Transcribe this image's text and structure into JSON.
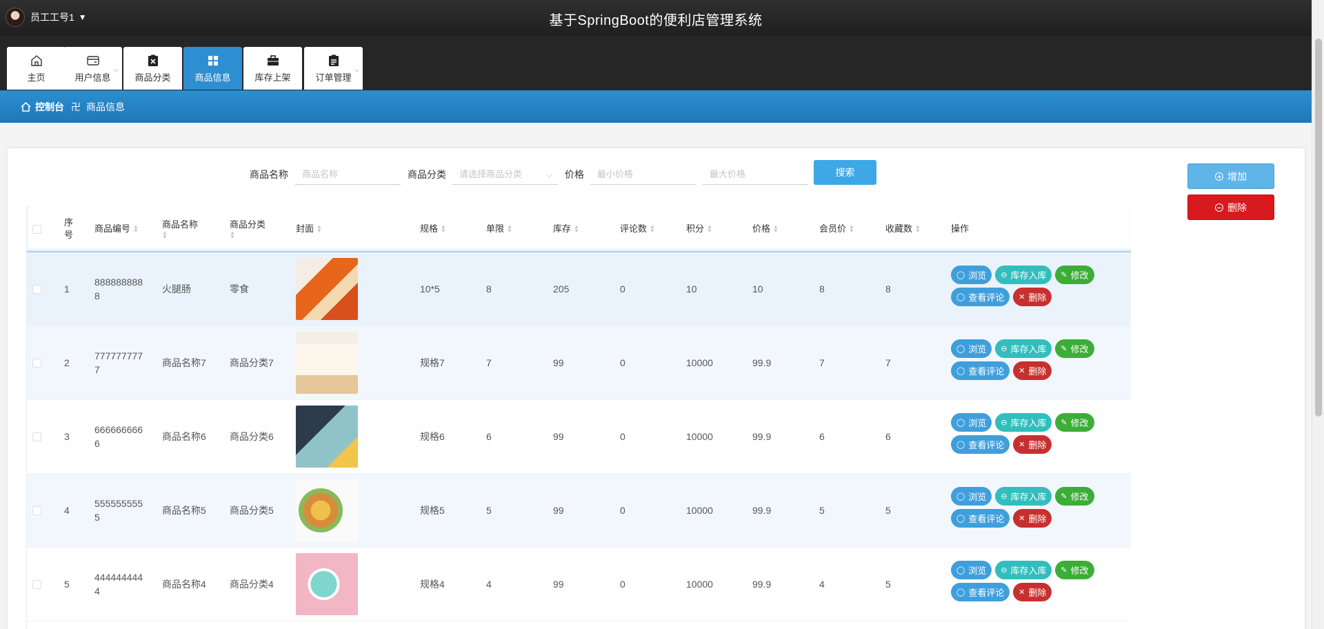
{
  "header": {
    "user_name": "员工工号1",
    "system_title": "基于SpringBoot的便利店管理系统"
  },
  "nav": {
    "items": [
      {
        "label": "主页",
        "icon": "home-icon"
      },
      {
        "label": "用户信息",
        "icon": "wallet-icon"
      },
      {
        "label": "商品分类",
        "icon": "clipboard-x-icon"
      },
      {
        "label": "商品信息",
        "icon": "grid-icon"
      },
      {
        "label": "库存上架",
        "icon": "briefcase-icon"
      },
      {
        "label": "订单管理",
        "icon": "clipboard-icon"
      }
    ],
    "active": "商品信息"
  },
  "breadcrumb": {
    "root": "控制台",
    "current": "商品信息"
  },
  "search": {
    "name_label": "商品名称",
    "name_placeholder": "商品名称",
    "category_label": "商品分类",
    "category_placeholder": "请选择商品分类",
    "price_label": "价格",
    "min_price_placeholder": "最小价格",
    "max_price_placeholder": "最大价格",
    "search_button": "搜索"
  },
  "side_actions": {
    "add": "增加",
    "delete": "删除"
  },
  "table": {
    "columns": {
      "index": "序号",
      "code": "商品编号",
      "name": "商品名称",
      "category": "商品分类",
      "cover": "封面",
      "spec": "规格",
      "limit": "单限",
      "stock": "库存",
      "comments": "评论数",
      "points": "积分",
      "price": "价格",
      "member_price": "会员价",
      "favorites": "收藏数",
      "actions": "操作"
    },
    "actions": {
      "view": "浏览",
      "stock_in": "库存入库",
      "edit": "修改",
      "reviews": "查看评论",
      "delete": "删除"
    },
    "rows": [
      {
        "index": "1",
        "code_a": "888888888",
        "code_b": "8",
        "name": "火腿肠",
        "category": "零食",
        "spec": "10*5",
        "limit": "8",
        "stock": "205",
        "comments": "0",
        "points": "10",
        "price": "10",
        "member_price": "8",
        "favorites": "8"
      },
      {
        "index": "2",
        "code_a": "777777777",
        "code_b": "7",
        "name": "商品名称7",
        "category": "商品分类7",
        "spec": "规格7",
        "limit": "7",
        "stock": "99",
        "comments": "0",
        "points": "10000",
        "price": "99.9",
        "member_price": "7",
        "favorites": "7"
      },
      {
        "index": "3",
        "code_a": "666666666",
        "code_b": "6",
        "name": "商品名称6",
        "category": "商品分类6",
        "spec": "规格6",
        "limit": "6",
        "stock": "99",
        "comments": "0",
        "points": "10000",
        "price": "99.9",
        "member_price": "6",
        "favorites": "6"
      },
      {
        "index": "4",
        "code_a": "555555555",
        "code_b": "5",
        "name": "商品名称5",
        "category": "商品分类5",
        "spec": "规格5",
        "limit": "5",
        "stock": "99",
        "comments": "0",
        "points": "10000",
        "price": "99.9",
        "member_price": "5",
        "favorites": "5"
      },
      {
        "index": "5",
        "code_a": "444444444",
        "code_b": "4",
        "name": "商品名称4",
        "category": "商品分类4",
        "spec": "规格4",
        "limit": "4",
        "stock": "99",
        "comments": "0",
        "points": "10000",
        "price": "99.9",
        "member_price": "4",
        "favorites": "5"
      }
    ]
  },
  "colors": {
    "primary": "#2d8fd2",
    "danger": "#d8191e",
    "success": "#3cad37",
    "teal": "#33bdbd"
  }
}
